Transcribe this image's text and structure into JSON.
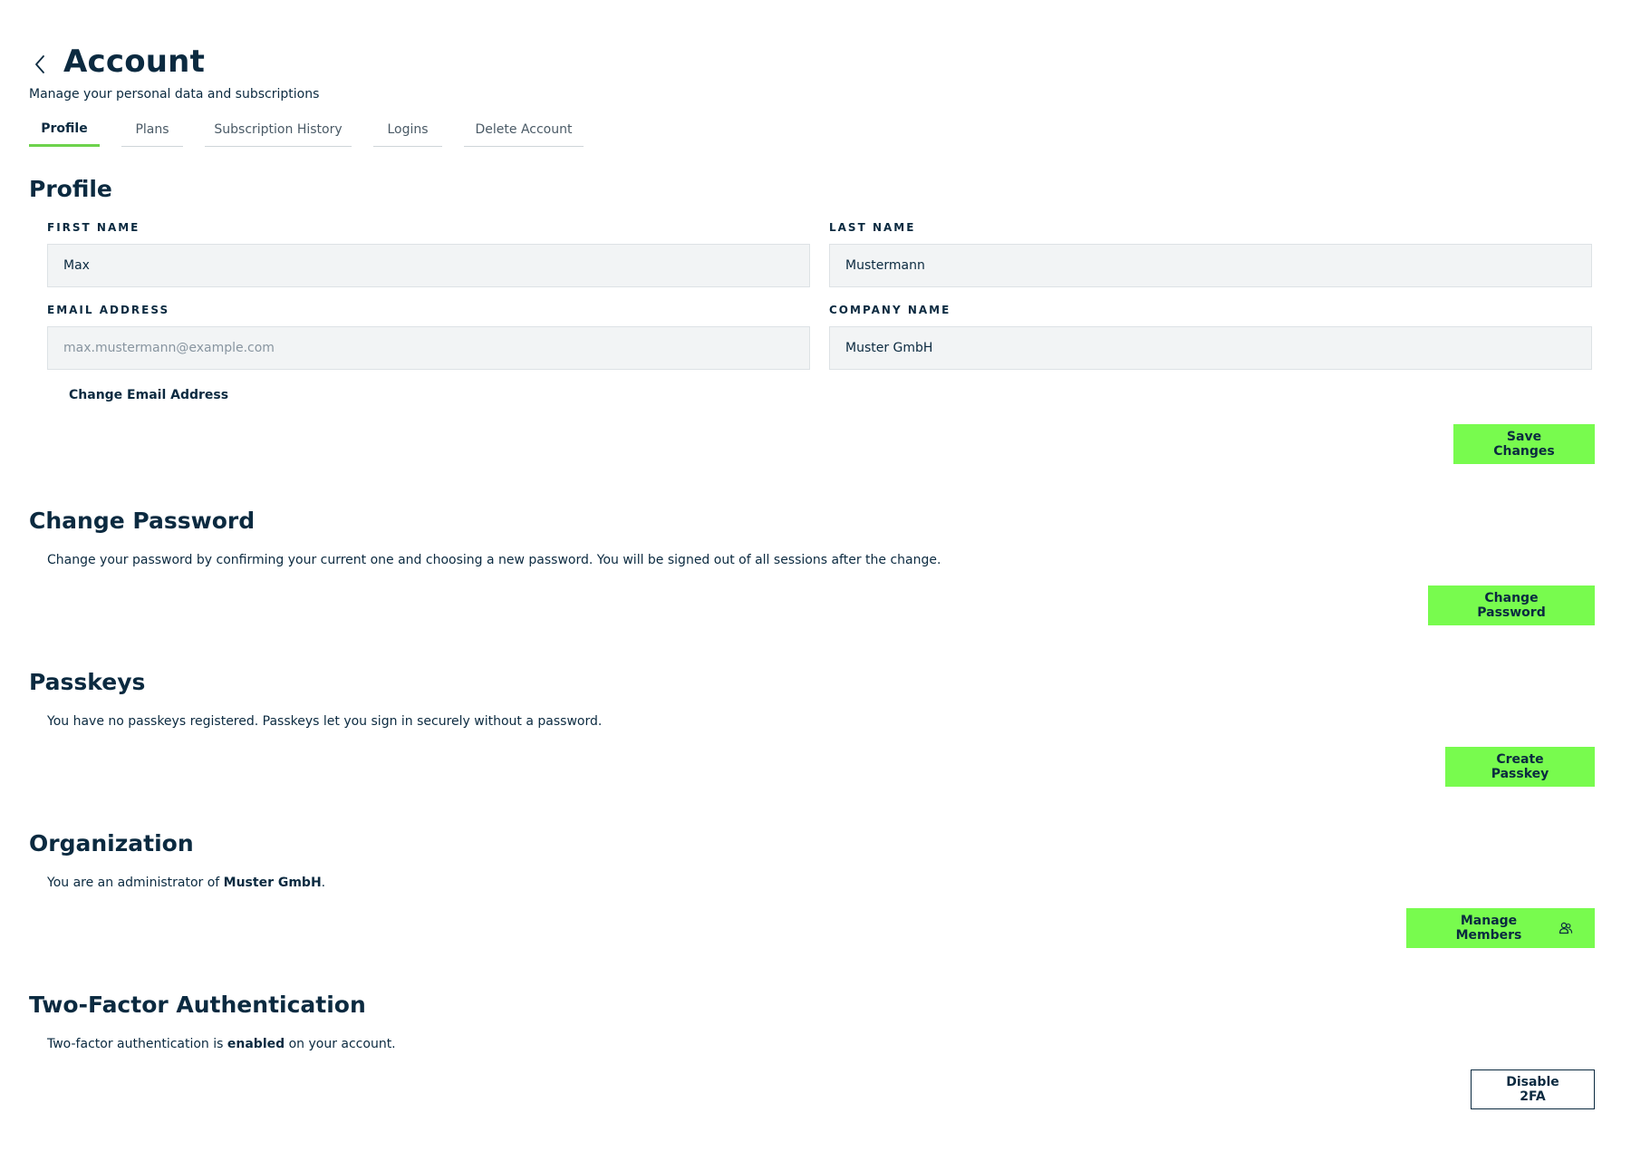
{
  "header": {
    "title": "Account",
    "subtitle": "Manage your personal data and subscriptions",
    "back_icon": "chevron-left-icon"
  },
  "tabs": [
    {
      "label": "Profile",
      "active": true
    },
    {
      "label": "Plans",
      "active": false
    },
    {
      "label": "Subscription History",
      "active": false
    },
    {
      "label": "Logins",
      "active": false
    },
    {
      "label": "Delete Account",
      "active": false
    }
  ],
  "profile": {
    "title": "Profile",
    "first_name": {
      "label": "FIRST NAME",
      "value": "Max"
    },
    "last_name": {
      "label": "LAST NAME",
      "value": "Mustermann"
    },
    "email": {
      "label": "EMAIL ADDRESS",
      "value": "",
      "placeholder": "max.mustermann@example.com"
    },
    "company": {
      "label": "COMPANY NAME",
      "value": "Muster GmbH"
    },
    "change_email_label": "Change Email Address",
    "save_label": "Save Changes"
  },
  "password": {
    "title": "Change Password",
    "description": "Change your password by confirming your current one and choosing a new password. You will be signed out of all sessions after the change.",
    "button_label": "Change Password"
  },
  "passkeys": {
    "title": "Passkeys",
    "description": "You have no passkeys registered. Passkeys let you sign in securely without a password.",
    "button_label": "Create Passkey"
  },
  "organization": {
    "title": "Organization",
    "description_prefix": "You are an administrator of ",
    "org_name": "Muster GmbH",
    "description_suffix": ".",
    "button_label": "Manage Members",
    "button_icon": "users-icon"
  },
  "two_factor": {
    "title": "Two-Factor Authentication",
    "description_prefix": "Two-factor authentication is ",
    "status": "enabled",
    "description_suffix": " on your account.",
    "button_label": "Disable 2FA"
  },
  "colors": {
    "primary_text": "#0b2a40",
    "accent_green": "#78fb4e",
    "tab_underline": "#6dd24c",
    "input_bg": "#f2f4f5"
  }
}
